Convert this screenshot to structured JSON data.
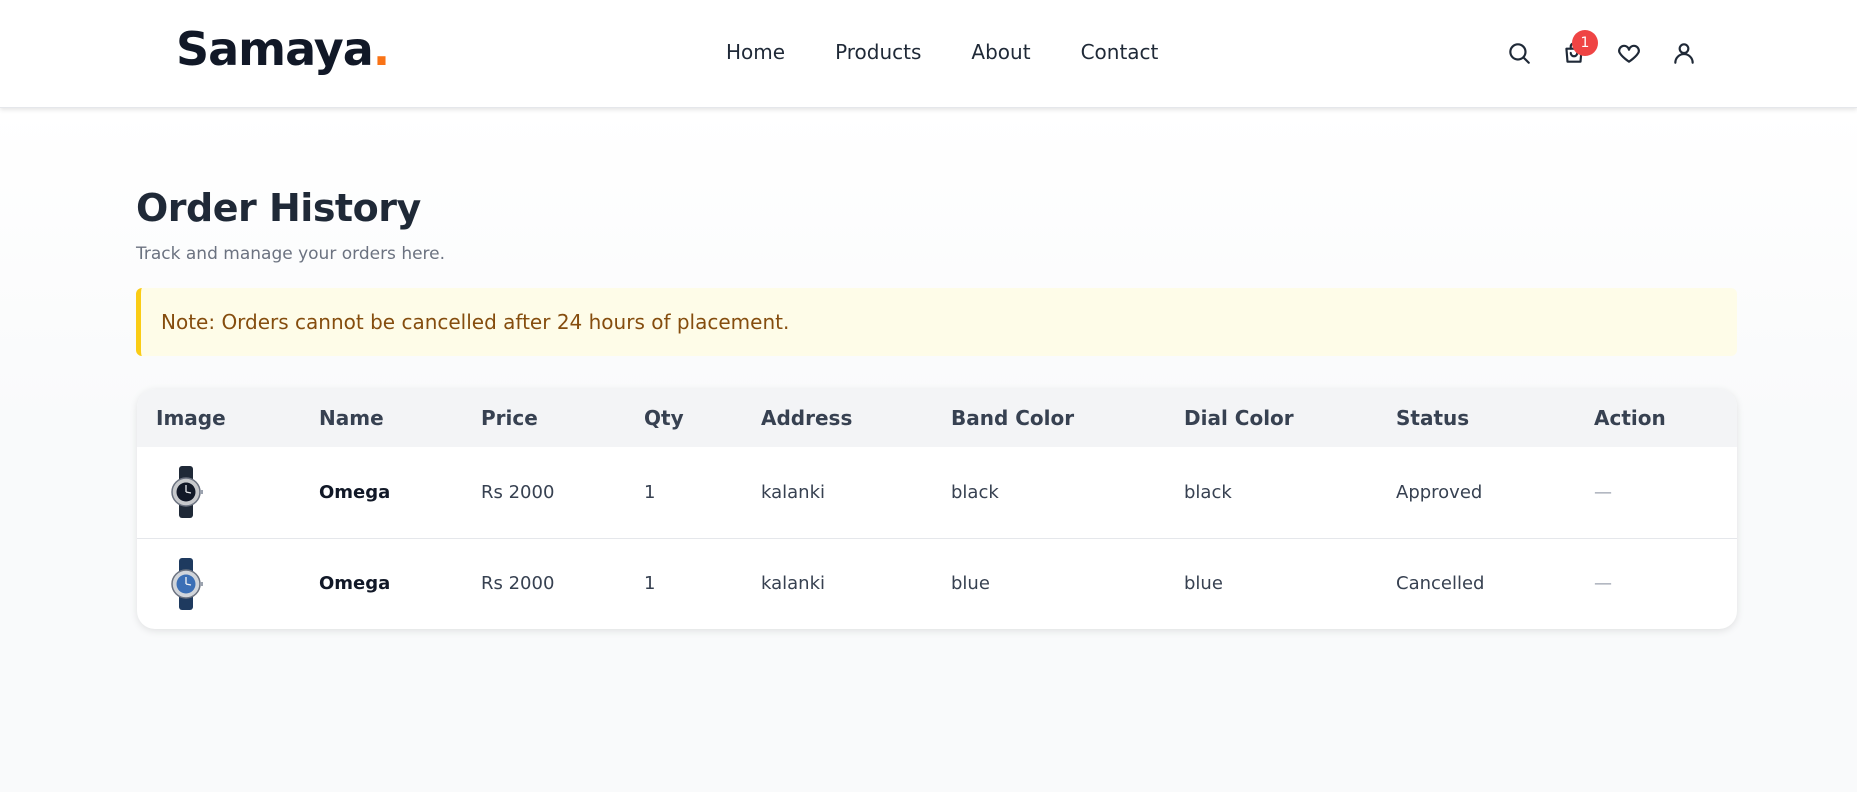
{
  "header": {
    "logo_text": "Samaya",
    "logo_dot": ".",
    "nav": [
      "Home",
      "Products",
      "About",
      "Contact"
    ],
    "cart_count": "1",
    "icons": [
      "search-icon",
      "cart-icon",
      "heart-icon",
      "user-icon"
    ]
  },
  "main": {
    "title": "Order History",
    "subtitle": "Track and manage your orders here.",
    "note": "Note: Orders cannot be cancelled after 24 hours of placement."
  },
  "table": {
    "columns": [
      "Image",
      "Name",
      "Price",
      "Qty",
      "Address",
      "Band Color",
      "Dial Color",
      "Status",
      "Action"
    ],
    "rows": [
      {
        "name": "Omega",
        "price": "Rs 2000",
        "qty": "1",
        "address": "kalanki",
        "band_color": "black",
        "dial_color": "black",
        "status": "Approved",
        "action": "—",
        "image": "watch-black-icon"
      },
      {
        "name": "Omega",
        "price": "Rs 2000",
        "qty": "1",
        "address": "kalanki",
        "band_color": "blue",
        "dial_color": "blue",
        "status": "Cancelled",
        "action": "—",
        "image": "watch-blue-icon"
      }
    ]
  },
  "colors": {
    "accent": "#f97316",
    "badge": "#ef4444",
    "note_bg": "#fefce8",
    "note_border": "#facc15",
    "note_text": "#854d0e"
  }
}
